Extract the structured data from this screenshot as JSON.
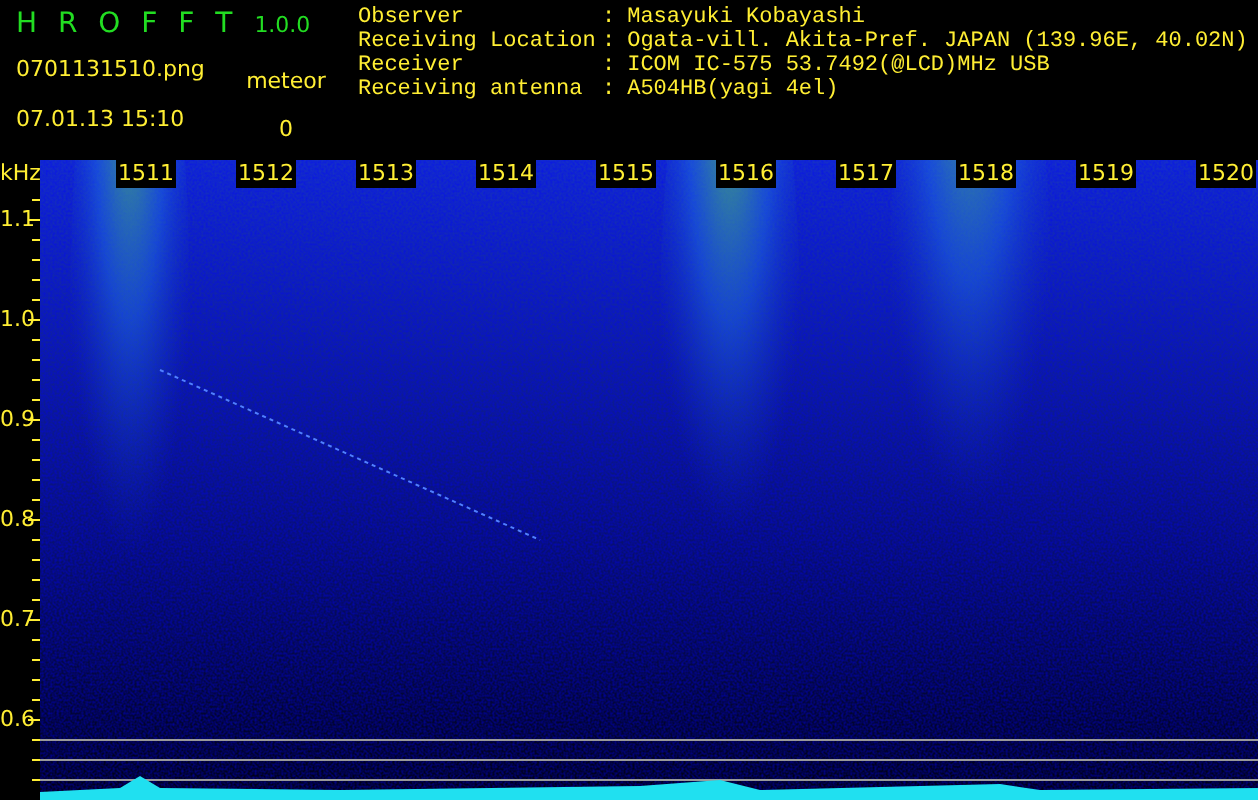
{
  "app": {
    "name": "H R O F F T",
    "version": "1.0.0"
  },
  "file": {
    "name": "0701131510.png",
    "timestamp": "07.01.13 15:10"
  },
  "counter": {
    "label": "meteor",
    "value": "0"
  },
  "info": [
    {
      "label": "Observer",
      "separator": ":",
      "value": "Masayuki Kobayashi"
    },
    {
      "label": "Receiving Location",
      "separator": ":",
      "value": "Ogata-vill. Akita-Pref. JAPAN (139.96E, 40.02N)"
    },
    {
      "label": "Receiver",
      "separator": ":",
      "value": "ICOM IC-575 53.7492(@LCD)MHz USB"
    },
    {
      "label": "Receiving antenna",
      "separator": ":",
      "value": "A504HB(yagi 4el)"
    }
  ],
  "spectrogram": {
    "unit": "kHz",
    "time_labels": [
      "1511",
      "1512",
      "1513",
      "1514",
      "1515",
      "1516",
      "1517",
      "1518",
      "1519",
      "1520"
    ],
    "frequency_labels": [
      "1.1",
      "1.0",
      "0.9",
      "0.8",
      "0.7",
      "0.6"
    ]
  }
}
